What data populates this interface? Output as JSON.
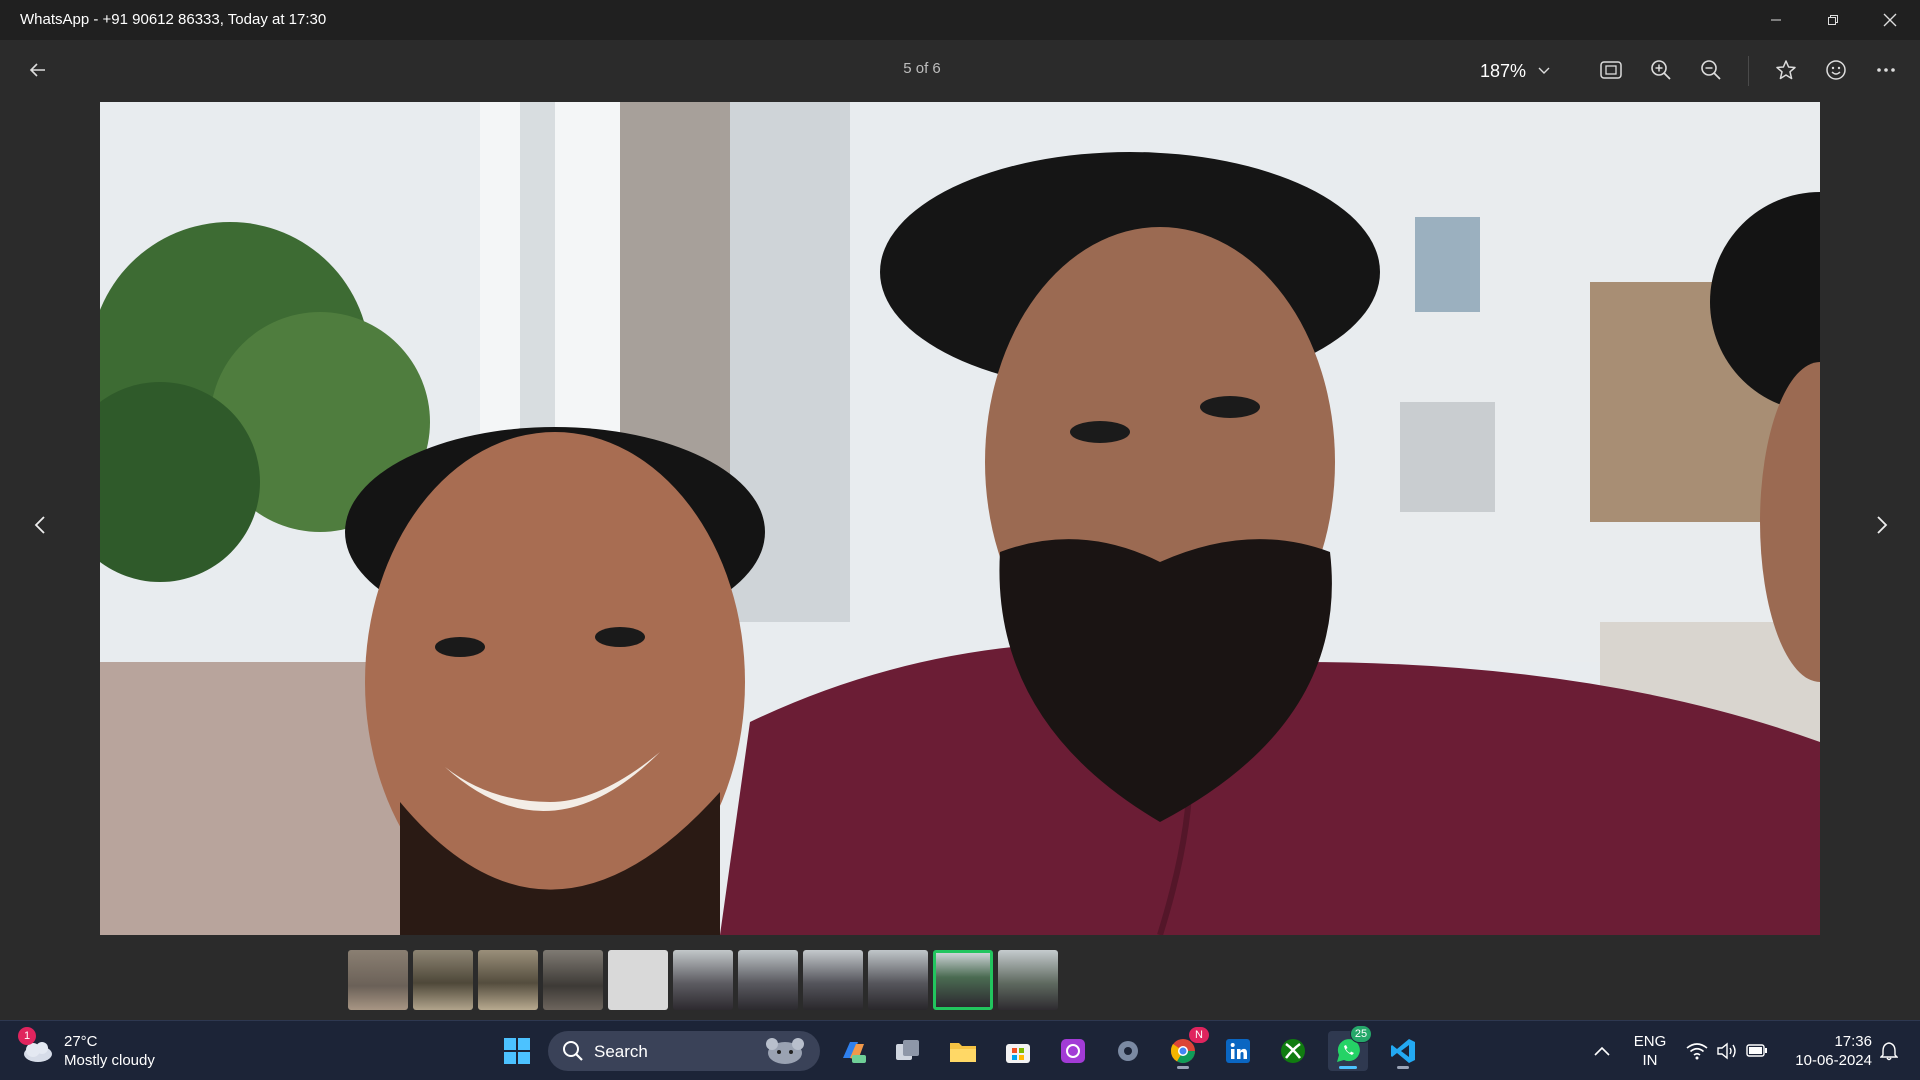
{
  "window": {
    "title": "WhatsApp - +91 90612 86333, Today at 17:30"
  },
  "toolbar": {
    "counter": "5 of 6",
    "zoom_level": "187%"
  },
  "thumbnails": {
    "count": 11,
    "active_index": 9
  },
  "taskbar": {
    "weather": {
      "badge": "1",
      "temperature": "27°C",
      "condition": "Mostly cloudy"
    },
    "search_label": "Search",
    "chrome_badge": "N",
    "whatsapp_badge": "25",
    "language": "ENG",
    "region": "IN",
    "time": "17:36",
    "date": "10-06-2024"
  },
  "colors": {
    "accent_green": "#22c55e",
    "taskbar_bg": "#1c2437",
    "shirt": "#6b1d35"
  },
  "icons": [
    "back-arrow-icon",
    "chevron-down-icon",
    "fit-screen-icon",
    "zoom-in-icon",
    "zoom-out-icon",
    "star-icon",
    "emoji-icon",
    "more-icon",
    "chevron-left-icon",
    "chevron-right-icon",
    "windows-start-icon",
    "search-icon",
    "copilot-icon",
    "task-view-icon",
    "file-explorer-icon",
    "store-icon",
    "photos-app-icon",
    "settings-icon",
    "chrome-icon",
    "linkedin-icon",
    "xbox-icon",
    "whatsapp-icon",
    "vscode-icon",
    "wifi-icon",
    "volume-icon",
    "battery-icon",
    "notification-bell-icon"
  ]
}
